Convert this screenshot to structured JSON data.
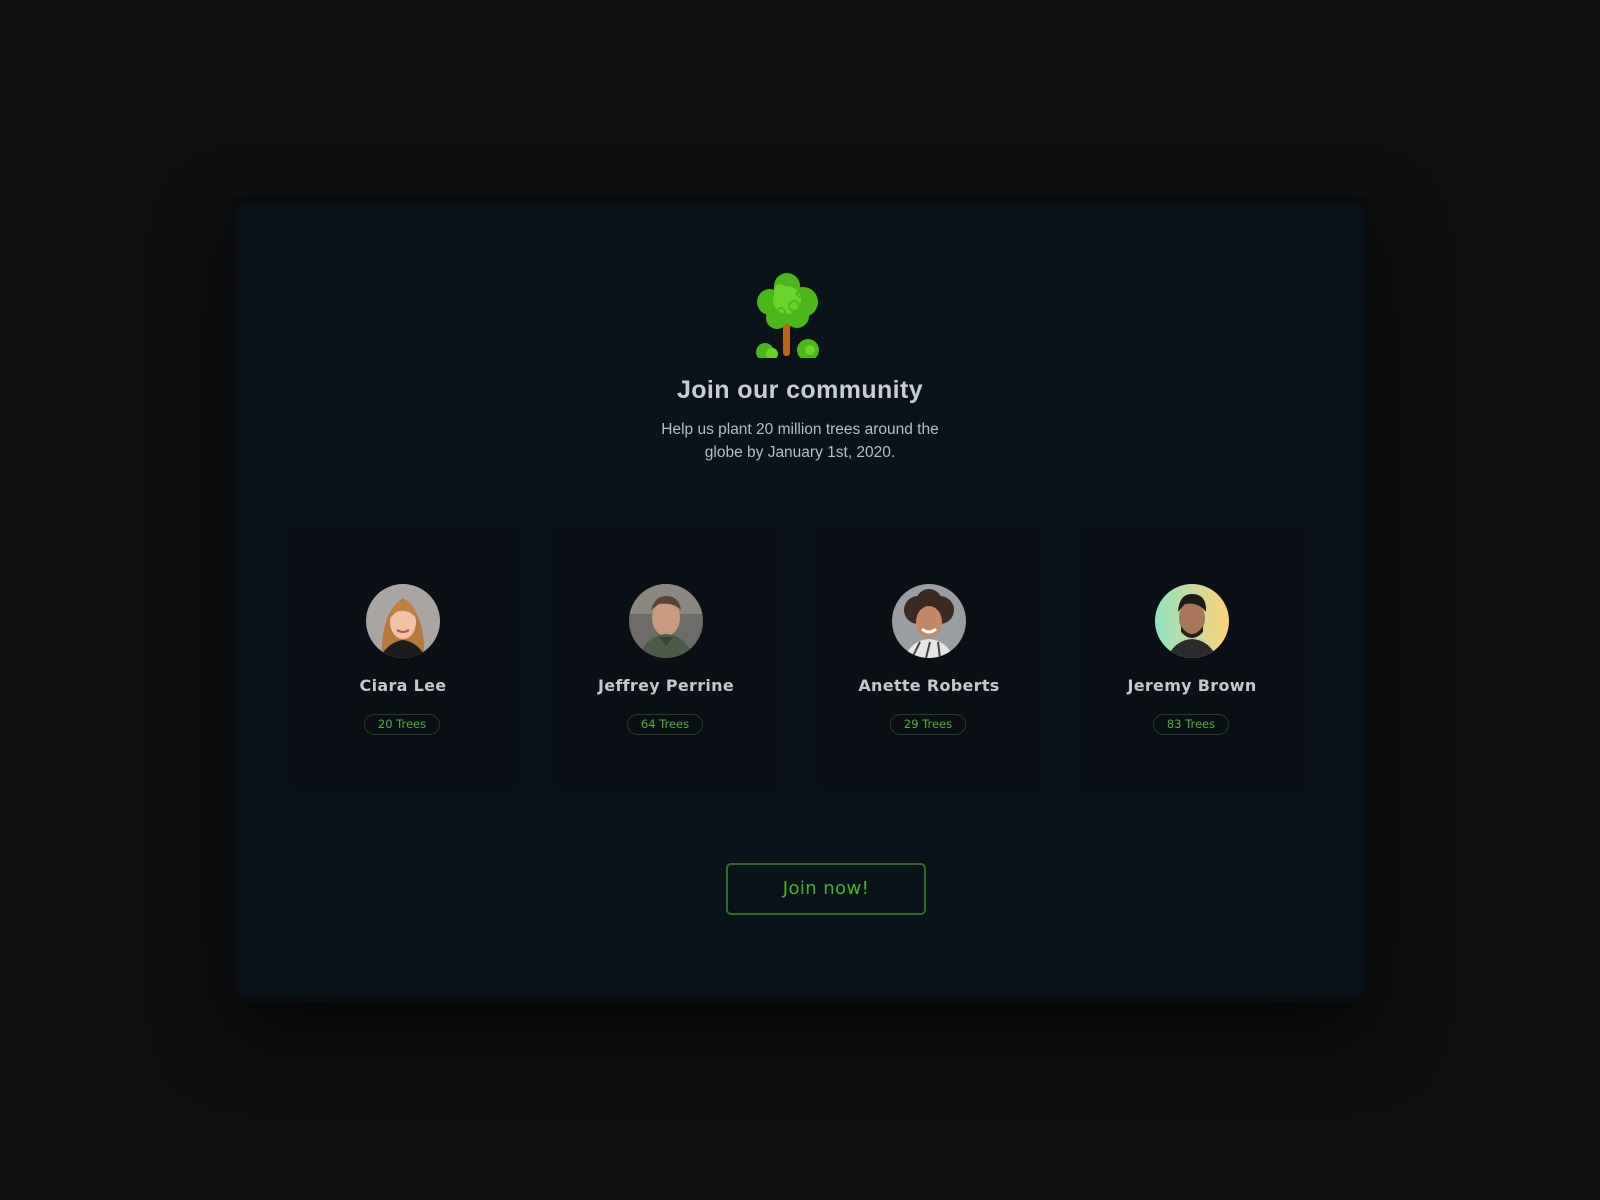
{
  "hero": {
    "icon": "tree-icon",
    "title": "Join our community",
    "subtitle": "Help us plant 20 million trees around the globe by January 1st, 2020."
  },
  "members": [
    {
      "name": "Ciara Lee",
      "trees": "20 Trees",
      "avatar": "avatar-ciara-lee"
    },
    {
      "name": "Jeffrey Perrine",
      "trees": "64 Trees",
      "avatar": "avatar-jeffrey-perrine"
    },
    {
      "name": "Anette Roberts",
      "trees": "29 Trees",
      "avatar": "avatar-anette-roberts"
    },
    {
      "name": "Jeremy Brown",
      "trees": "83 Trees",
      "avatar": "avatar-jeremy-brown"
    }
  ],
  "cta": {
    "label": "Join now!"
  },
  "colors": {
    "background": "#0f1012",
    "panel": "#0b131a",
    "card": "#0a1015",
    "accent_green": "#4cae2c",
    "badge_border": "#22402a",
    "heading_text": "#c9ccd0"
  }
}
